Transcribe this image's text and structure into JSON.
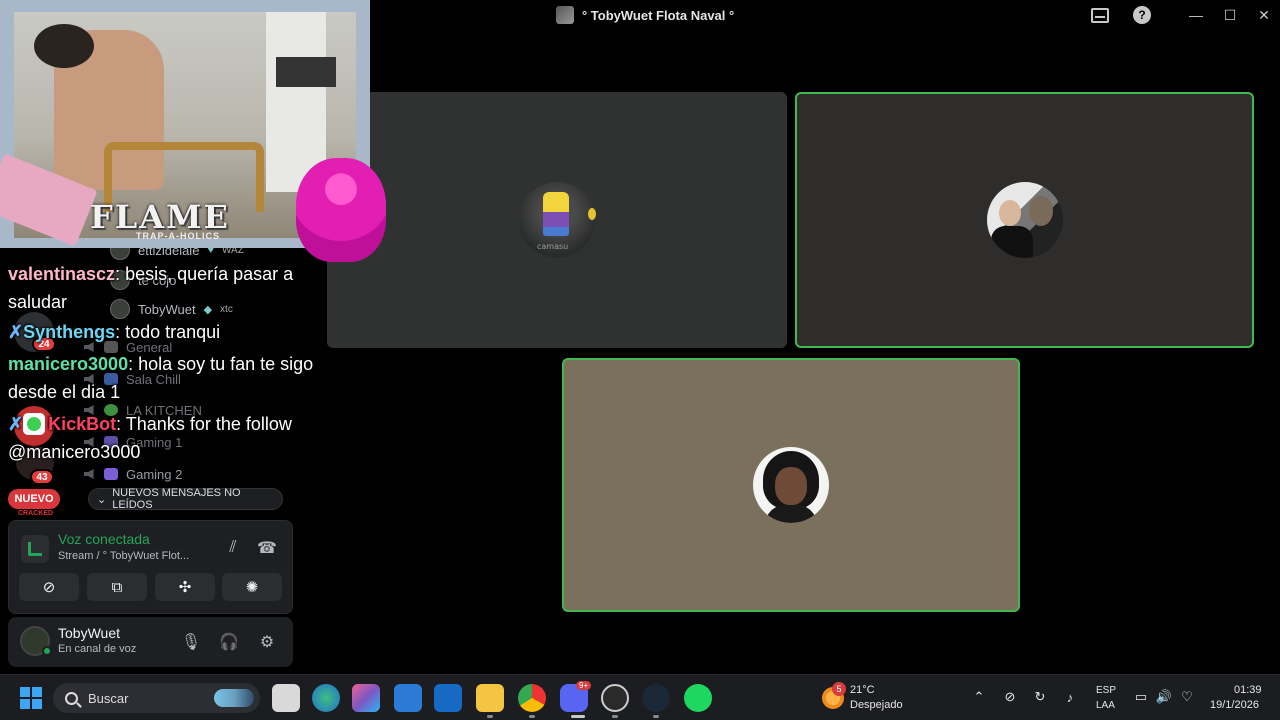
{
  "window": {
    "title": "° TobyWuet Flota Naval °",
    "minimize": "—",
    "maximize": "☐",
    "close": "✕",
    "help": "?"
  },
  "participants": [
    {
      "name_caption": "camasu",
      "accent": "#2f3230"
    },
    {
      "speaking": true,
      "accent": "#3fb950"
    },
    {
      "speaking": true,
      "accent": "#3fb950"
    }
  ],
  "overlay": {
    "banner_title": "FLAME",
    "banner_subtitle": "TRAP-A-HOLICS"
  },
  "sidebar": {
    "members": [
      {
        "name": "ettizidelaie",
        "badge": "WAZ"
      },
      {
        "name": "te cojo"
      },
      {
        "name": "TobyWuet",
        "badge": "xtc"
      }
    ],
    "channels": [
      "General",
      "Sala Chill",
      "LA KITCHEN",
      "Gaming 1",
      "Gaming 2"
    ],
    "server_badges": [
      "24",
      "43"
    ],
    "nuevo_label": "NUEVO",
    "cracked_label": "CRACKED",
    "unread_label": "NUEVOS MENSAJES NO LEÍDOS"
  },
  "chat": [
    {
      "user": "valentinascz",
      "color": "#ffb6c8",
      "text": ": besis, quería pasar a saludar"
    },
    {
      "user": "Synthengs",
      "color": "#6ad7f5",
      "text": ": todo tranqui",
      "pinned": true
    },
    {
      "user": "manicero3000",
      "color": "#5ee0a8",
      "text": ": hola soy tu fan te sigo desde el dia 1"
    },
    {
      "user": "KickBot",
      "color": "#ff4060",
      "text": ": Thanks for the follow @manicero3000",
      "pinned": true
    }
  ],
  "voice": {
    "title": "Voz conectada",
    "subtitle": "Stream / ° TobyWuet Flot..."
  },
  "user": {
    "name": "TobyWuet",
    "status": "En canal de voz"
  },
  "taskbar": {
    "search_placeholder": "Buscar",
    "discord_badge": "9+",
    "weather_alert": "5",
    "weather_temp": "21°C",
    "weather_desc": "Despejado",
    "lang": "ESP",
    "layout": "LAA",
    "time": "01:39",
    "date": "19/1/2026"
  }
}
